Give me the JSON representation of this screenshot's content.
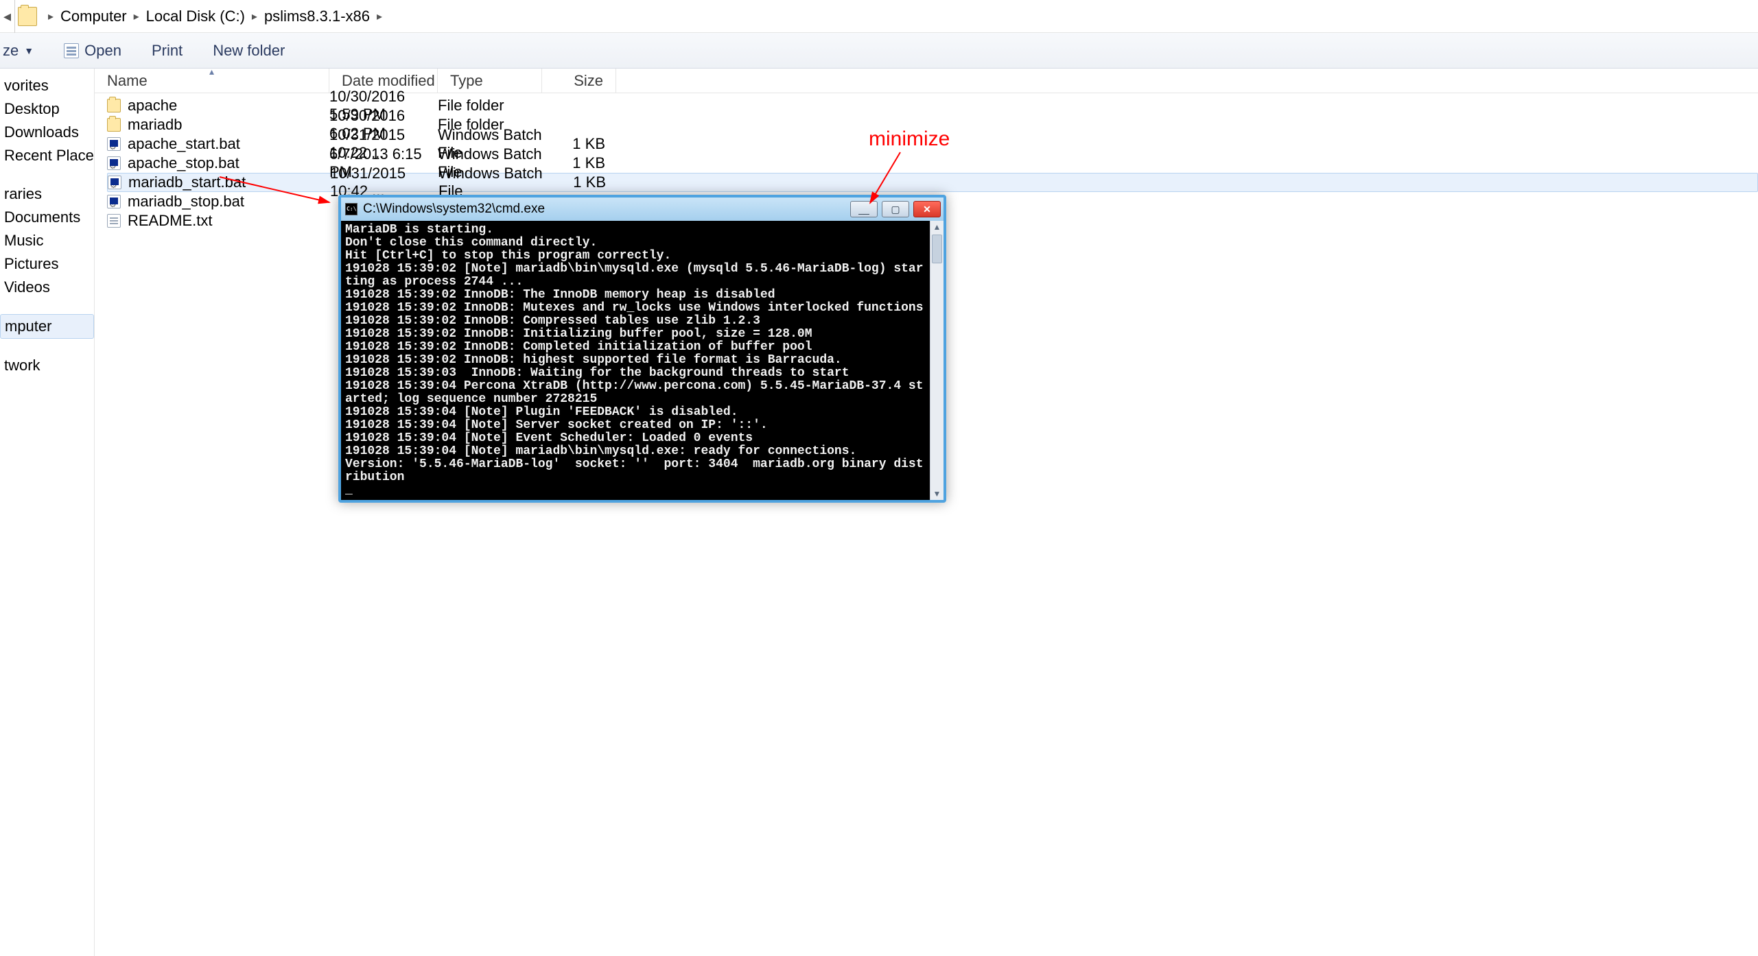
{
  "breadcrumb": {
    "items": [
      "Computer",
      "Local Disk (C:)",
      "pslims8.3.1-x86"
    ]
  },
  "toolbar": {
    "ze": "ze",
    "open": "Open",
    "print": "Print",
    "newfolder": "New folder"
  },
  "sidebar": {
    "items1": [
      "vorites",
      "Desktop",
      "Downloads",
      "Recent Places"
    ],
    "items2": [
      "raries",
      "Documents",
      "Music",
      "Pictures",
      "Videos"
    ],
    "items3": [
      "mputer"
    ],
    "items4": [
      "twork"
    ]
  },
  "columns": {
    "name": "Name",
    "date": "Date modified",
    "type": "Type",
    "size": "Size"
  },
  "files": [
    {
      "icon": "folder",
      "name": "apache",
      "date": "10/30/2016 5:59 PM",
      "type": "File folder",
      "size": ""
    },
    {
      "icon": "folder",
      "name": "mariadb",
      "date": "10/30/2016 6:02 PM",
      "type": "File folder",
      "size": ""
    },
    {
      "icon": "bat",
      "name": "apache_start.bat",
      "date": "10/31/2015 10:22 ...",
      "type": "Windows Batch File",
      "size": "1 KB"
    },
    {
      "icon": "bat",
      "name": "apache_stop.bat",
      "date": "6/7/2013 6:15 PM",
      "type": "Windows Batch File",
      "size": "1 KB"
    },
    {
      "icon": "bat",
      "name": "mariadb_start.bat",
      "date": "10/31/2015 10:42 ...",
      "type": "Windows Batch File",
      "size": "1 KB",
      "selected": true
    },
    {
      "icon": "bat",
      "name": "mariadb_stop.bat",
      "date": "",
      "type": "",
      "size": ""
    },
    {
      "icon": "txt",
      "name": "README.txt",
      "date": "",
      "type": "",
      "size": ""
    }
  ],
  "cmd": {
    "title": "C:\\Windows\\system32\\cmd.exe",
    "output": "MariaDB is starting.\nDon't close this command directly.\nHit [Ctrl+C] to stop this program correctly.\n191028 15:39:02 [Note] mariadb\\bin\\mysqld.exe (mysqld 5.5.46-MariaDB-log) starting as process 2744 ...\n191028 15:39:02 InnoDB: The InnoDB memory heap is disabled\n191028 15:39:02 InnoDB: Mutexes and rw_locks use Windows interlocked functions\n191028 15:39:02 InnoDB: Compressed tables use zlib 1.2.3\n191028 15:39:02 InnoDB: Initializing buffer pool, size = 128.0M\n191028 15:39:02 InnoDB: Completed initialization of buffer pool\n191028 15:39:02 InnoDB: highest supported file format is Barracuda.\n191028 15:39:03  InnoDB: Waiting for the background threads to start\n191028 15:39:04 Percona XtraDB (http://www.percona.com) 5.5.45-MariaDB-37.4 started; log sequence number 2728215\n191028 15:39:04 [Note] Plugin 'FEEDBACK' is disabled.\n191028 15:39:04 [Note] Server socket created on IP: '::'.\n191028 15:39:04 [Note] Event Scheduler: Loaded 0 events\n191028 15:39:04 [Note] mariadb\\bin\\mysqld.exe: ready for connections.\nVersion: '5.5.46-MariaDB-log'  socket: ''  port: 3404  mariadb.org binary distribution\n_"
  },
  "annotation": {
    "label": "minimize"
  }
}
